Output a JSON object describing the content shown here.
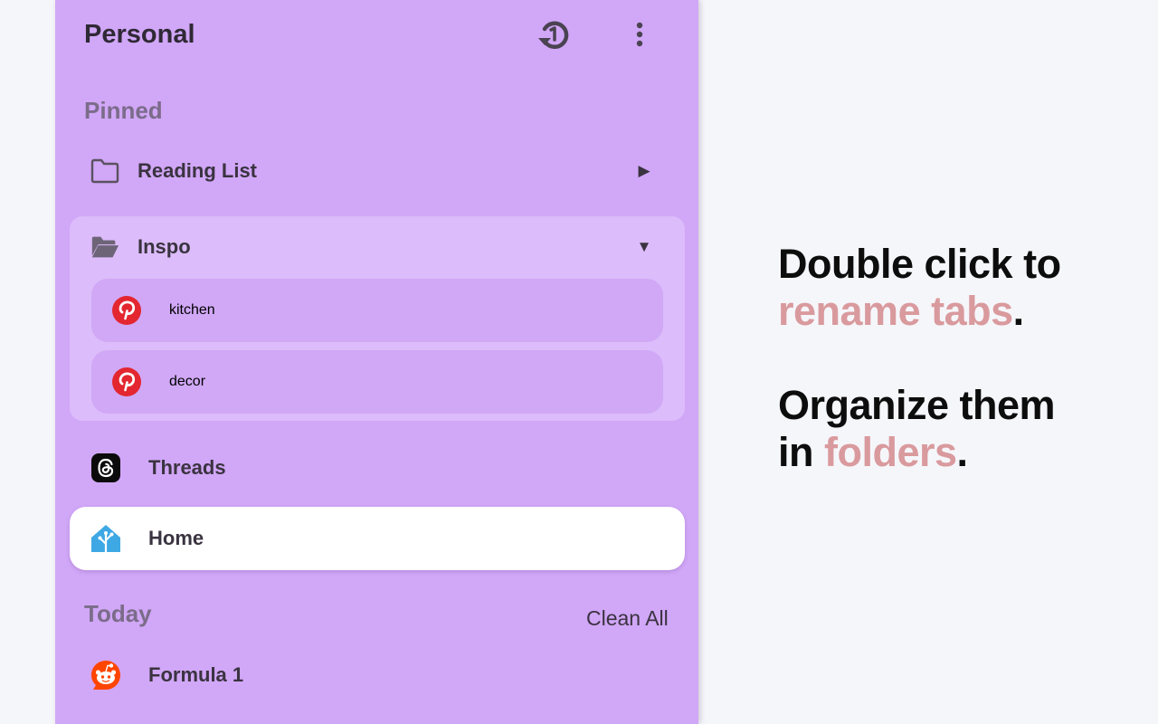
{
  "sidebar": {
    "space_title": "Personal",
    "header_icons": {
      "history": "history-icon",
      "more": "more-vertical-icon"
    },
    "pinned_label": "Pinned",
    "folders": [
      {
        "label": "Reading List",
        "icon": "folder-icon",
        "state": "collapsed",
        "caret": "▶"
      },
      {
        "label": "Inspo",
        "icon": "folder-open-icon",
        "state": "expanded",
        "caret": "▼",
        "children": [
          {
            "label": "kitchen",
            "icon": "pinterest-icon"
          },
          {
            "label": "decor",
            "icon": "pinterest-icon"
          }
        ]
      }
    ],
    "pinned_tabs": [
      {
        "label": "Threads",
        "icon": "threads-icon",
        "active": false
      },
      {
        "label": "Home",
        "icon": "home-assistant-icon",
        "active": true
      }
    ],
    "today_label": "Today",
    "clean_all_label": "Clean All",
    "today_tabs": [
      {
        "label": "Formula 1",
        "icon": "reddit-icon"
      }
    ]
  },
  "promo": {
    "line1": "Double click to",
    "line2_accent": "rename tabs",
    "line2_end": ".",
    "line3": "Organize them",
    "line4_start": "in ",
    "line4_accent": "folders",
    "line4_end": "."
  },
  "colors": {
    "sidebar_bg": "#d1a7f7",
    "accent_text": "#d99a9e",
    "page_bg": "#f5f6fa",
    "active_tab_bg": "#ffffff"
  }
}
